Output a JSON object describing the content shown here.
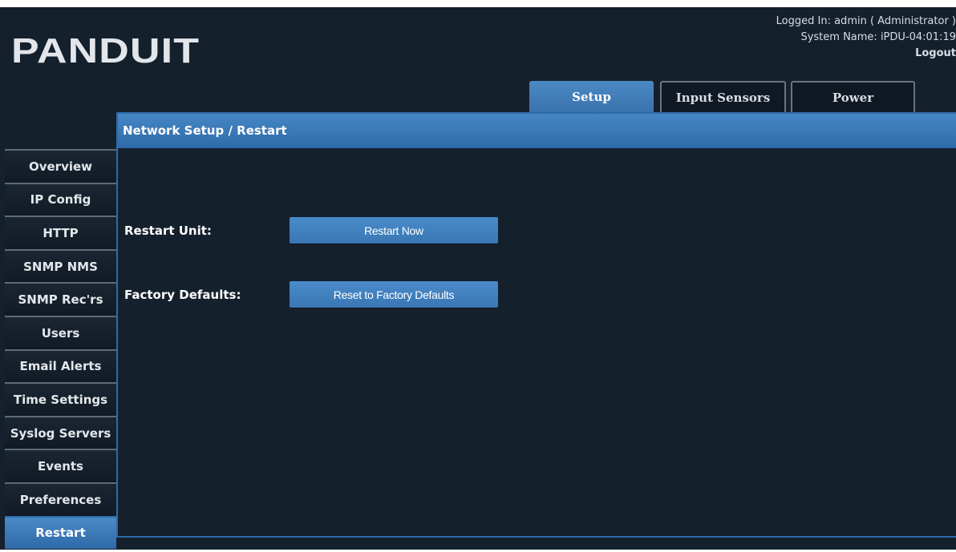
{
  "header": {
    "logo_text": "PANDUIT",
    "logged_in": "Logged In: admin ( Administrator )",
    "system_name": "System Name: iPDU-04:01:19",
    "logout_label": "Logout"
  },
  "tabs": [
    {
      "label": "Setup",
      "active": true
    },
    {
      "label": "Input Sensors",
      "active": false
    },
    {
      "label": "Power",
      "active": false
    }
  ],
  "sidebar": {
    "items": [
      {
        "label": "Overview"
      },
      {
        "label": "IP Config"
      },
      {
        "label": "HTTP"
      },
      {
        "label": "SNMP NMS"
      },
      {
        "label": "SNMP Rec'rs"
      },
      {
        "label": "Users"
      },
      {
        "label": "Email Alerts"
      },
      {
        "label": "Time Settings"
      },
      {
        "label": "Syslog Servers"
      },
      {
        "label": "Events"
      },
      {
        "label": "Preferences"
      },
      {
        "label": "Restart",
        "active": true
      }
    ]
  },
  "main": {
    "panel_title": "Network Setup / Restart",
    "restart_label": "Restart Unit:",
    "restart_button": "Restart Now",
    "factory_label": "Factory Defaults:",
    "factory_button": "Reset to Factory Defaults"
  },
  "colors": {
    "background": "#15202d",
    "accent": "#3a76b3"
  }
}
